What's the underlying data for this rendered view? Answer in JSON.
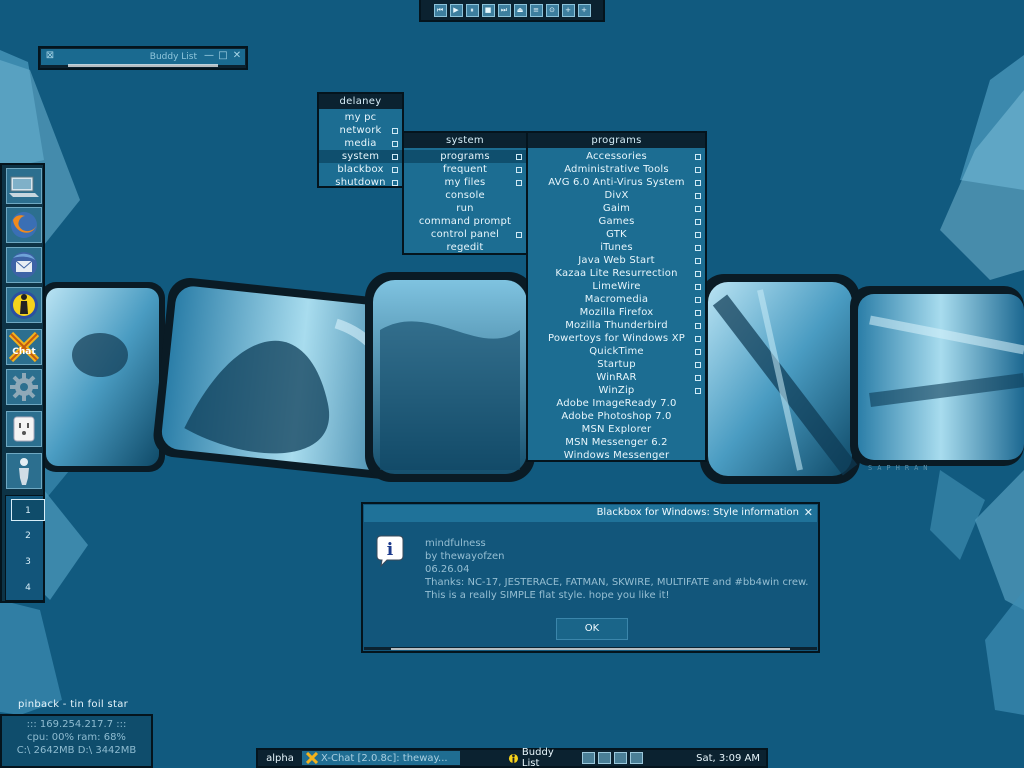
{
  "media_bar": {
    "buttons": [
      {
        "name": "previous-track-icon",
        "glyph": "⏮"
      },
      {
        "name": "play-icon",
        "glyph": "▶"
      },
      {
        "name": "pause-icon",
        "glyph": "⏸"
      },
      {
        "name": "stop-icon",
        "glyph": "■"
      },
      {
        "name": "next-track-icon",
        "glyph": "⏭"
      },
      {
        "name": "eject-icon",
        "glyph": "⏏"
      },
      {
        "name": "playlist-icon",
        "glyph": "≡"
      },
      {
        "name": "settings-icon",
        "glyph": "⊙"
      },
      {
        "name": "volume-up-icon",
        "glyph": "+"
      },
      {
        "name": "volume-down-icon",
        "glyph": "+"
      }
    ]
  },
  "buddy_window": {
    "title": "Buddy List",
    "min": "—",
    "max": "□",
    "close": "✕",
    "pin": "⊠"
  },
  "root_menu": {
    "title": "delaney",
    "items": [
      {
        "label": "my pc",
        "sub": false,
        "active": false
      },
      {
        "label": "network",
        "sub": true,
        "active": false
      },
      {
        "label": "media",
        "sub": true,
        "active": false
      },
      {
        "label": "system",
        "sub": true,
        "active": true
      },
      {
        "label": "blackbox",
        "sub": true,
        "active": false
      },
      {
        "label": "shutdown",
        "sub": true,
        "active": false
      }
    ]
  },
  "system_menu": {
    "title": "system",
    "items": [
      {
        "label": "programs",
        "sub": true,
        "active": true
      },
      {
        "label": "frequent",
        "sub": true,
        "active": false
      },
      {
        "label": "my files",
        "sub": true,
        "active": false
      },
      {
        "label": "console",
        "sub": false,
        "active": false
      },
      {
        "label": "run",
        "sub": false,
        "active": false
      },
      {
        "label": "command prompt",
        "sub": false,
        "active": false
      },
      {
        "label": "control panel",
        "sub": true,
        "active": false
      },
      {
        "label": "regedit",
        "sub": false,
        "active": false
      }
    ]
  },
  "programs_menu": {
    "title": "programs",
    "items": [
      {
        "label": "Accessories",
        "sub": true
      },
      {
        "label": "Administrative Tools",
        "sub": true
      },
      {
        "label": "AVG 6.0 Anti-Virus System",
        "sub": true
      },
      {
        "label": "DivX",
        "sub": true
      },
      {
        "label": "Gaim",
        "sub": true
      },
      {
        "label": "Games",
        "sub": true
      },
      {
        "label": "GTK",
        "sub": true
      },
      {
        "label": "iTunes",
        "sub": true
      },
      {
        "label": "Java Web Start",
        "sub": true
      },
      {
        "label": "Kazaa Lite Resurrection",
        "sub": true
      },
      {
        "label": "LimeWire",
        "sub": true
      },
      {
        "label": "Macromedia",
        "sub": true
      },
      {
        "label": "Mozilla Firefox",
        "sub": true
      },
      {
        "label": "Mozilla Thunderbird",
        "sub": true
      },
      {
        "label": "Powertoys for Windows XP",
        "sub": true
      },
      {
        "label": "QuickTime",
        "sub": true
      },
      {
        "label": "Startup",
        "sub": true
      },
      {
        "label": "WinRAR",
        "sub": true
      },
      {
        "label": "WinZip",
        "sub": true
      },
      {
        "label": "Adobe ImageReady 7.0",
        "sub": false
      },
      {
        "label": "Adobe Photoshop 7.0",
        "sub": false
      },
      {
        "label": "MSN Explorer",
        "sub": false
      },
      {
        "label": "MSN Messenger 6.2",
        "sub": false
      },
      {
        "label": "Windows Messenger",
        "sub": false
      }
    ]
  },
  "dock": {
    "icons": [
      "my-computer-icon",
      "firefox-icon",
      "thunderbird-icon",
      "aim-icon",
      "xchat-icon",
      "gear-icon",
      "power-outlet-icon",
      "figure-icon"
    ],
    "xchat_text": "Chat",
    "desktops": [
      "1",
      "2",
      "3",
      "4"
    ],
    "current_desktop": 0
  },
  "dialog": {
    "title": "Blackbox for Windows: Style information",
    "close": "✕",
    "info_glyph": "i",
    "lines": [
      "mindfulness",
      "by thewayofzen",
      "06.26.04",
      "Thanks: NC-17, JESTERACE, FATMAN, SKWIRE, MULTIFATE and #bb4win crew.",
      "This is a really SIMPLE flat style.  hope you like it!"
    ],
    "ok_label": "OK"
  },
  "wallpaper_signature": "SAPHRAN",
  "now_playing": "pinback - tin foil star",
  "system_monitor": {
    "ip": "::: 169.254.217.7 :::",
    "cpu_ram": "cpu: 00%    ram: 68%",
    "disks": "C:\\ 2642MB  D:\\ 3442MB"
  },
  "taskbar": {
    "workspace": "alpha",
    "tasks": [
      {
        "label": "X-Chat [2.0.8c]: theway...",
        "active": true,
        "icon": "xchat-task-icon"
      },
      {
        "label": "Buddy List",
        "active": false,
        "icon": "aim-task-icon"
      }
    ],
    "tray_icons": [
      "network-tray-icon",
      "sound-tray-icon",
      "messenger-tray-icon",
      "aim-tray-icon"
    ],
    "clock": "Sat, 3:09 AM"
  },
  "colors": {
    "desktop": "#115a7f",
    "frame": "#04141d",
    "menu_body": "#1c6d92",
    "menu_title": "#0b2230",
    "highlight": "#0f4f6e"
  }
}
